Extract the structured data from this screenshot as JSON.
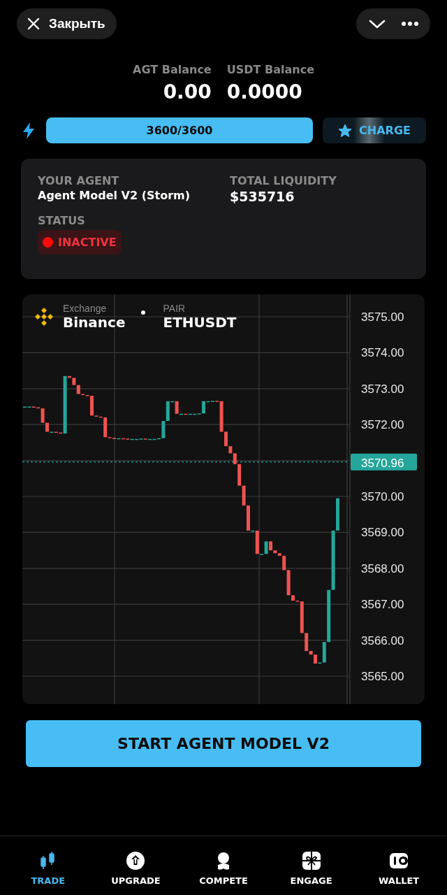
{
  "header": {
    "close_label": "Закрыть"
  },
  "balances": [
    {
      "label": "AGT Balance",
      "value": "0.00"
    },
    {
      "label": "USDT Balance",
      "value": "0.0000"
    }
  ],
  "energy": {
    "level": 1,
    "reading": "3600/3600",
    "button": "CHARGE"
  },
  "agent": {
    "agent_label": "YOUR AGENT",
    "agent_name": "Agent Model V2 (Storm)",
    "liquidity_label": "TOTAL LIQUIDITY",
    "liquidity_value": "$535716",
    "status_label": "STATUS",
    "status": "INACTIVE",
    "active": false
  },
  "chart": {
    "exchange_label": "Exchange",
    "exchange": "Binance",
    "pair_label": "PAIR",
    "pair": "ETHUSDT",
    "price_ticks": [
      "3575.00",
      "3574.00",
      "3573.00",
      "3572.00",
      "3570.00",
      "3569.00",
      "3568.00",
      "3567.00",
      "3566.00",
      "3565.00"
    ],
    "current_price": "3570.96"
  },
  "start_button": "START AGENT MODEL V2",
  "nav": [
    {
      "label": "TRADE",
      "selected": true
    },
    {
      "label": "UPGRADE",
      "selected": false
    },
    {
      "label": "COMPETE",
      "selected": false
    },
    {
      "label": "ENGAGE",
      "selected": false
    },
    {
      "label": "WALLET",
      "selected": false
    }
  ]
}
